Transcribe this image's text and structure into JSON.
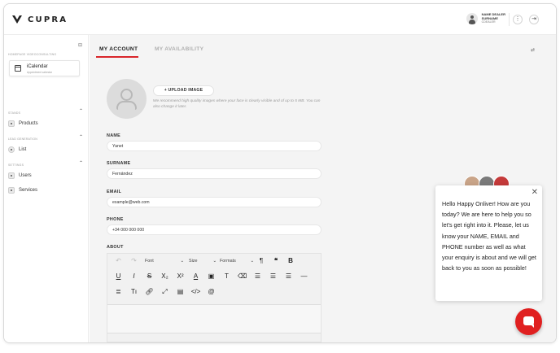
{
  "header": {
    "logo_text": "CUPRA",
    "user": {
      "name": "NAME DEALER",
      "surname": "SURNAME",
      "role": "CDEALER"
    },
    "menu_icon": "more-vertical-icon",
    "logout_icon": "logout-icon"
  },
  "sidebar": {
    "sections": {
      "top": "HOMEPAGE VIDEOCONSULTING",
      "stands": "STANDS",
      "lead_generation": "LEAD GENERATION",
      "settings": "SETTINGS"
    },
    "calendar": {
      "label": "iCalendar",
      "sub": "Appointment calendar"
    },
    "items": [
      {
        "label": "Products",
        "icon": "products-icon"
      },
      {
        "label": "List",
        "icon": "list-icon"
      },
      {
        "label": "Users",
        "icon": "users-icon"
      },
      {
        "label": "Services",
        "icon": "services-icon"
      }
    ]
  },
  "tabs": [
    {
      "label": "MY ACCOUNT",
      "active": true
    },
    {
      "label": "MY AVAILABILITY",
      "active": false
    }
  ],
  "profile": {
    "upload_label": "+ UPLOAD IMAGE",
    "upload_hint": "We recommend high quality images where your face is clearly visible and of up to 5 MB. You can also change it later."
  },
  "form": {
    "name": {
      "label": "NAME",
      "value": "Yanet"
    },
    "surname": {
      "label": "SURNAME",
      "value": "Fernández"
    },
    "email": {
      "label": "EMAIL",
      "value": "example@web.com"
    },
    "phone": {
      "label": "PHONE",
      "value": "+34 000 000 000"
    },
    "about": {
      "label": "ABOUT"
    }
  },
  "editor": {
    "font_label": "Font",
    "size_label": "Size",
    "formats_label": "Formats"
  },
  "chat": {
    "message": "Hello Happy Onliver! How are you today? We are here to help you so let's get right into it. Please, let us know your NAME, EMAIL and PHONE number as well as what your enquiry is about and we will get back to you as soon as possible!"
  },
  "colors": {
    "accent": "#d9262b",
    "chat_fab": "#e02020",
    "background": "#f4f4f4"
  }
}
